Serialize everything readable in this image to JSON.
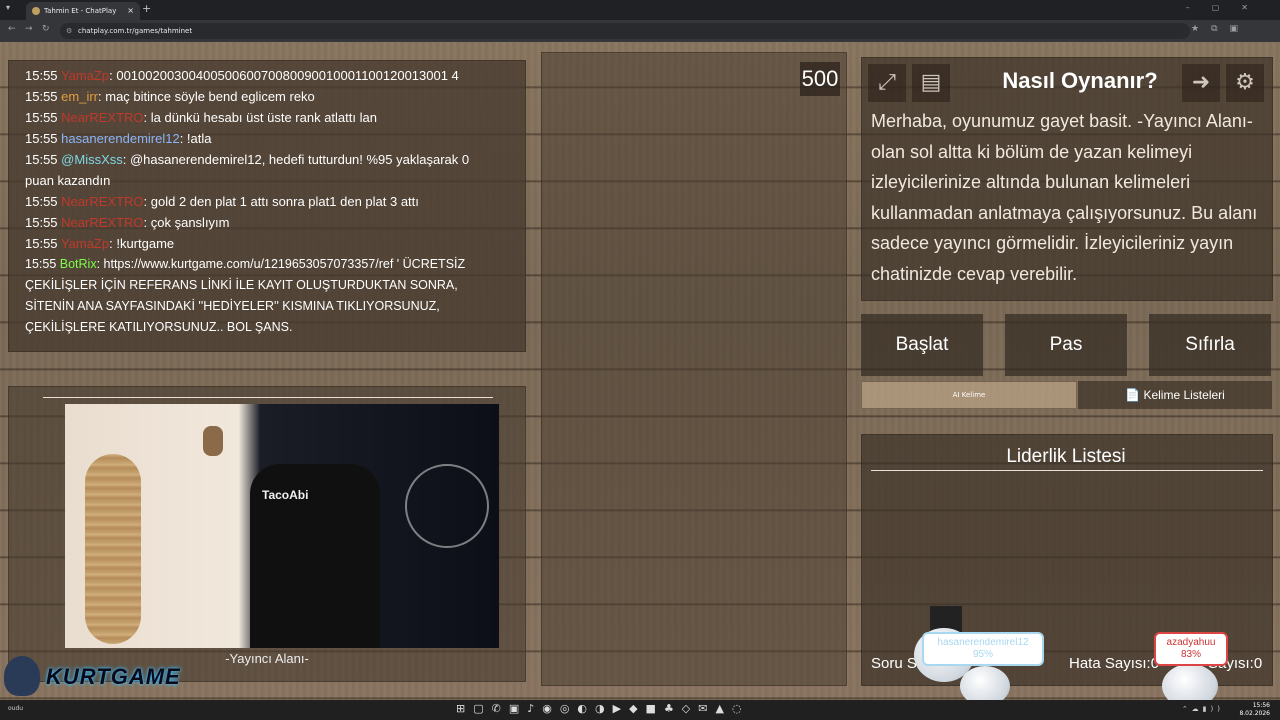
{
  "browser": {
    "tab_title": "Tahmin Et - ChatPlay",
    "url": "chatplay.com.tr/games/tahminet",
    "new_tab_symbol": "+",
    "tab_close_symbol": "×"
  },
  "chat": {
    "messages": [
      {
        "time": "15:55",
        "user": "YamaZp",
        "user_color": "#c0392b",
        "text": ": 0010020030040050060070080090010001100120013001 4"
      },
      {
        "time": "15:55",
        "user": "em_irr",
        "user_color": "#e0a040",
        "text": ": maç bitince söyle bend eglicem reko"
      },
      {
        "time": "15:55",
        "user": "NearREXTRO",
        "user_color": "#c0392b",
        "text": ": la dünkü hesabı üst üste rank atlattı lan"
      },
      {
        "time": "15:55",
        "user": "hasanerendemirel12",
        "user_color": "#8ab4f8",
        "text": ": !atla"
      },
      {
        "time": "15:55",
        "user": "@MissXss",
        "user_color": "#7fd8e8",
        "text": ": @hasanerendemirel12, hedefi tutturdun! %95 yaklaşarak 0 puan kazandın"
      },
      {
        "time": "15:55",
        "user": "NearREXTRO",
        "user_color": "#c0392b",
        "text": ": gold 2 den plat 1 attı sonra plat1 den plat 3 attı"
      },
      {
        "time": "15:55",
        "user": "NearREXTRO",
        "user_color": "#c0392b",
        "text": ": çok şanslıyım"
      },
      {
        "time": "15:55",
        "user": "YamaZp",
        "user_color": "#c0392b",
        "text": ": !kurtgame"
      },
      {
        "time": "15:55",
        "user": "BotRix",
        "user_color": "#7cfc4a",
        "text": ": https://www.kurtgame.com/u/1219653057073357/ref ' ÜCRETSİZ ÇEKİLİŞLER İÇİN REFERANS LİNKİ İLE KAYIT OLUŞTURDUKTAN SONRA, SİTENİN ANA SAYFASINDAKİ ''HEDİYELER'' KISMINA TIKLIYORSUNUZ, ÇEKİLİŞLERE KATILIYORSUNUZ.. BOL ŞANS."
      }
    ]
  },
  "streamer": {
    "label": "-Yayıncı Alanı-",
    "chair_brand": "TacoAbi"
  },
  "board": {
    "score": "500"
  },
  "how_to": {
    "title": "Nasıl Oynanır?",
    "text": "Merhaba, oyunumuz gayet basit. -Yayıncı Alanı- olan sol altta ki bölüm de yazan kelimeyi izleyicilerinize altında bulunan kelimeleri kullanmadan anlatmaya çalışıyorsunuz. Bu alanı sadece yayıncı görmelidir. İzleyicileriniz yayın chatinizde cevap verebilir."
  },
  "controls": {
    "start": "Başlat",
    "pass": "Pas",
    "reset": "Sıfırla",
    "tab_ai": "AI Kelime",
    "tab_lists": "Kelime Listeleri",
    "tab_lists_icon": "📄"
  },
  "leaderboard": {
    "title": "Liderlik Listesi",
    "question_count": "Soru Sa",
    "error_count": "Hata Sayısı:0",
    "third_count": "Sayısı:0"
  },
  "bubbles": {
    "blue_name": "hasanerendemirel12",
    "blue_pct": "95%",
    "red_name": "azadyahuu",
    "red_pct": "83%"
  },
  "logo": {
    "text": "KURTGAME"
  },
  "taskbar": {
    "time": "15:56",
    "date": "8.02.2026",
    "left_text": "oudu"
  }
}
